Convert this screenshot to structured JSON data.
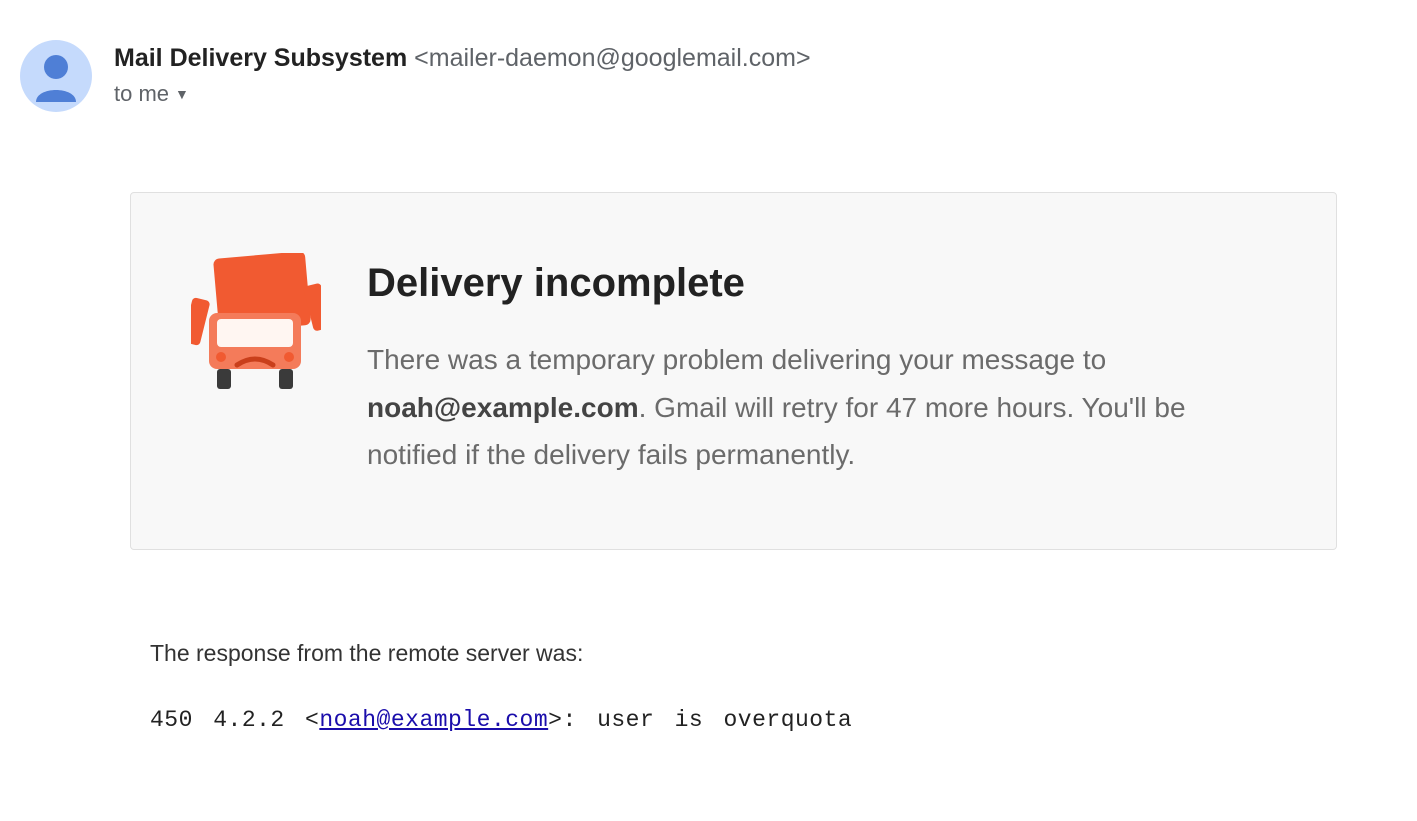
{
  "header": {
    "sender_name": "Mail Delivery Subsystem",
    "sender_email": "<mailer-daemon@googlemail.com>",
    "recipient_label": "to me"
  },
  "card": {
    "title": "Delivery incomplete",
    "msg_pre": "There was a temporary problem delivering your message to ",
    "msg_email": "noah@example.com",
    "msg_post": ". Gmail will retry for 47 more hours. You'll be notified if the delivery fails permanently."
  },
  "response": {
    "label": "The response from the remote server was:",
    "code_pre": "450 4.2.2 <",
    "code_email": "noah@example.com",
    "code_post": ">: user is overquota"
  }
}
